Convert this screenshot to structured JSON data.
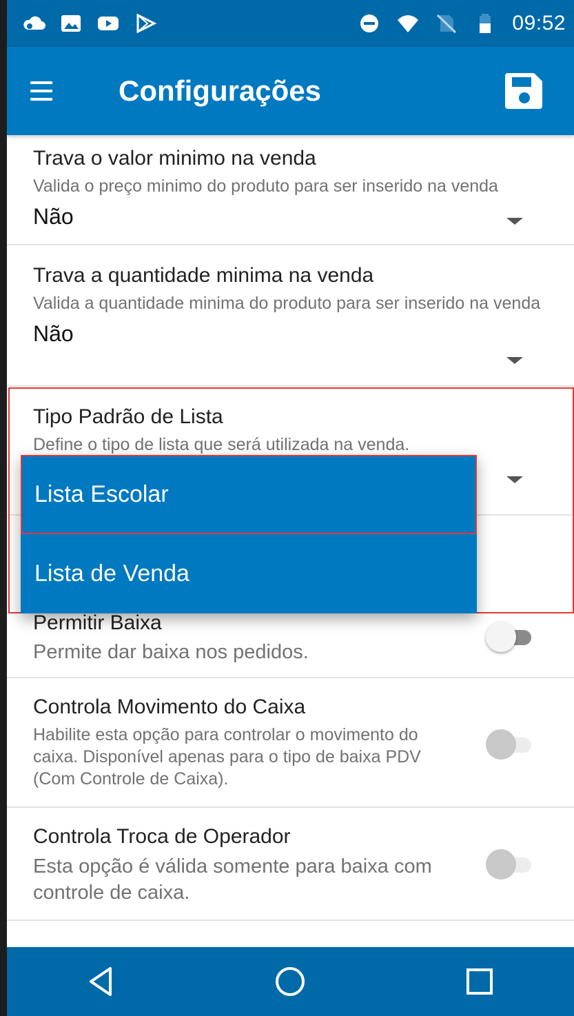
{
  "status_bar": {
    "time": "09:52",
    "left_icons": [
      "cloud-icon",
      "image-icon",
      "youtube-icon",
      "play-store-icon"
    ],
    "right_icons": [
      "do-not-disturb-icon",
      "wifi-icon",
      "no-sim-icon",
      "battery-icon"
    ]
  },
  "app_bar": {
    "title": "Configurações",
    "menu_icon": "menu-icon",
    "save_icon": "save-icon"
  },
  "settings": [
    {
      "title": "Trava o valor minimo na venda",
      "description": "Valida o preço minimo do produto para ser inserido na venda",
      "value": "Não"
    },
    {
      "title": "Trava a quantidade minima na venda",
      "description": "Valida a quantidade minima do produto para ser inserido na venda",
      "value": "Não"
    },
    {
      "title": "Tipo Padrão de Lista",
      "description": "Define o tipo de lista que será utilizada na venda."
    }
  ],
  "dropdown": {
    "options": [
      "Lista Escolar",
      "Lista de Venda"
    ],
    "selected_index": 0
  },
  "toggles": [
    {
      "title": "Permitir Baixa",
      "description": "Permite dar baixa nos pedidos.",
      "state": "off"
    },
    {
      "title": "Controla Movimento do Caixa",
      "description": "Habilite esta opção para controlar o movimento do caixa. Disponível apenas para o tipo de baixa PDV (Com Controle de Caixa).",
      "state": "off-disabled"
    },
    {
      "title": "Controla Troca de Operador",
      "description": "Esta opção é válida somente para baixa com controle de caixa.",
      "state": "off-disabled"
    }
  ],
  "nav_bar": {
    "buttons": [
      "back-icon",
      "home-icon",
      "recents-icon"
    ]
  },
  "colors": {
    "status_bar": "#0069a8",
    "app_bar": "#0079c0",
    "highlight": "#e53935"
  }
}
